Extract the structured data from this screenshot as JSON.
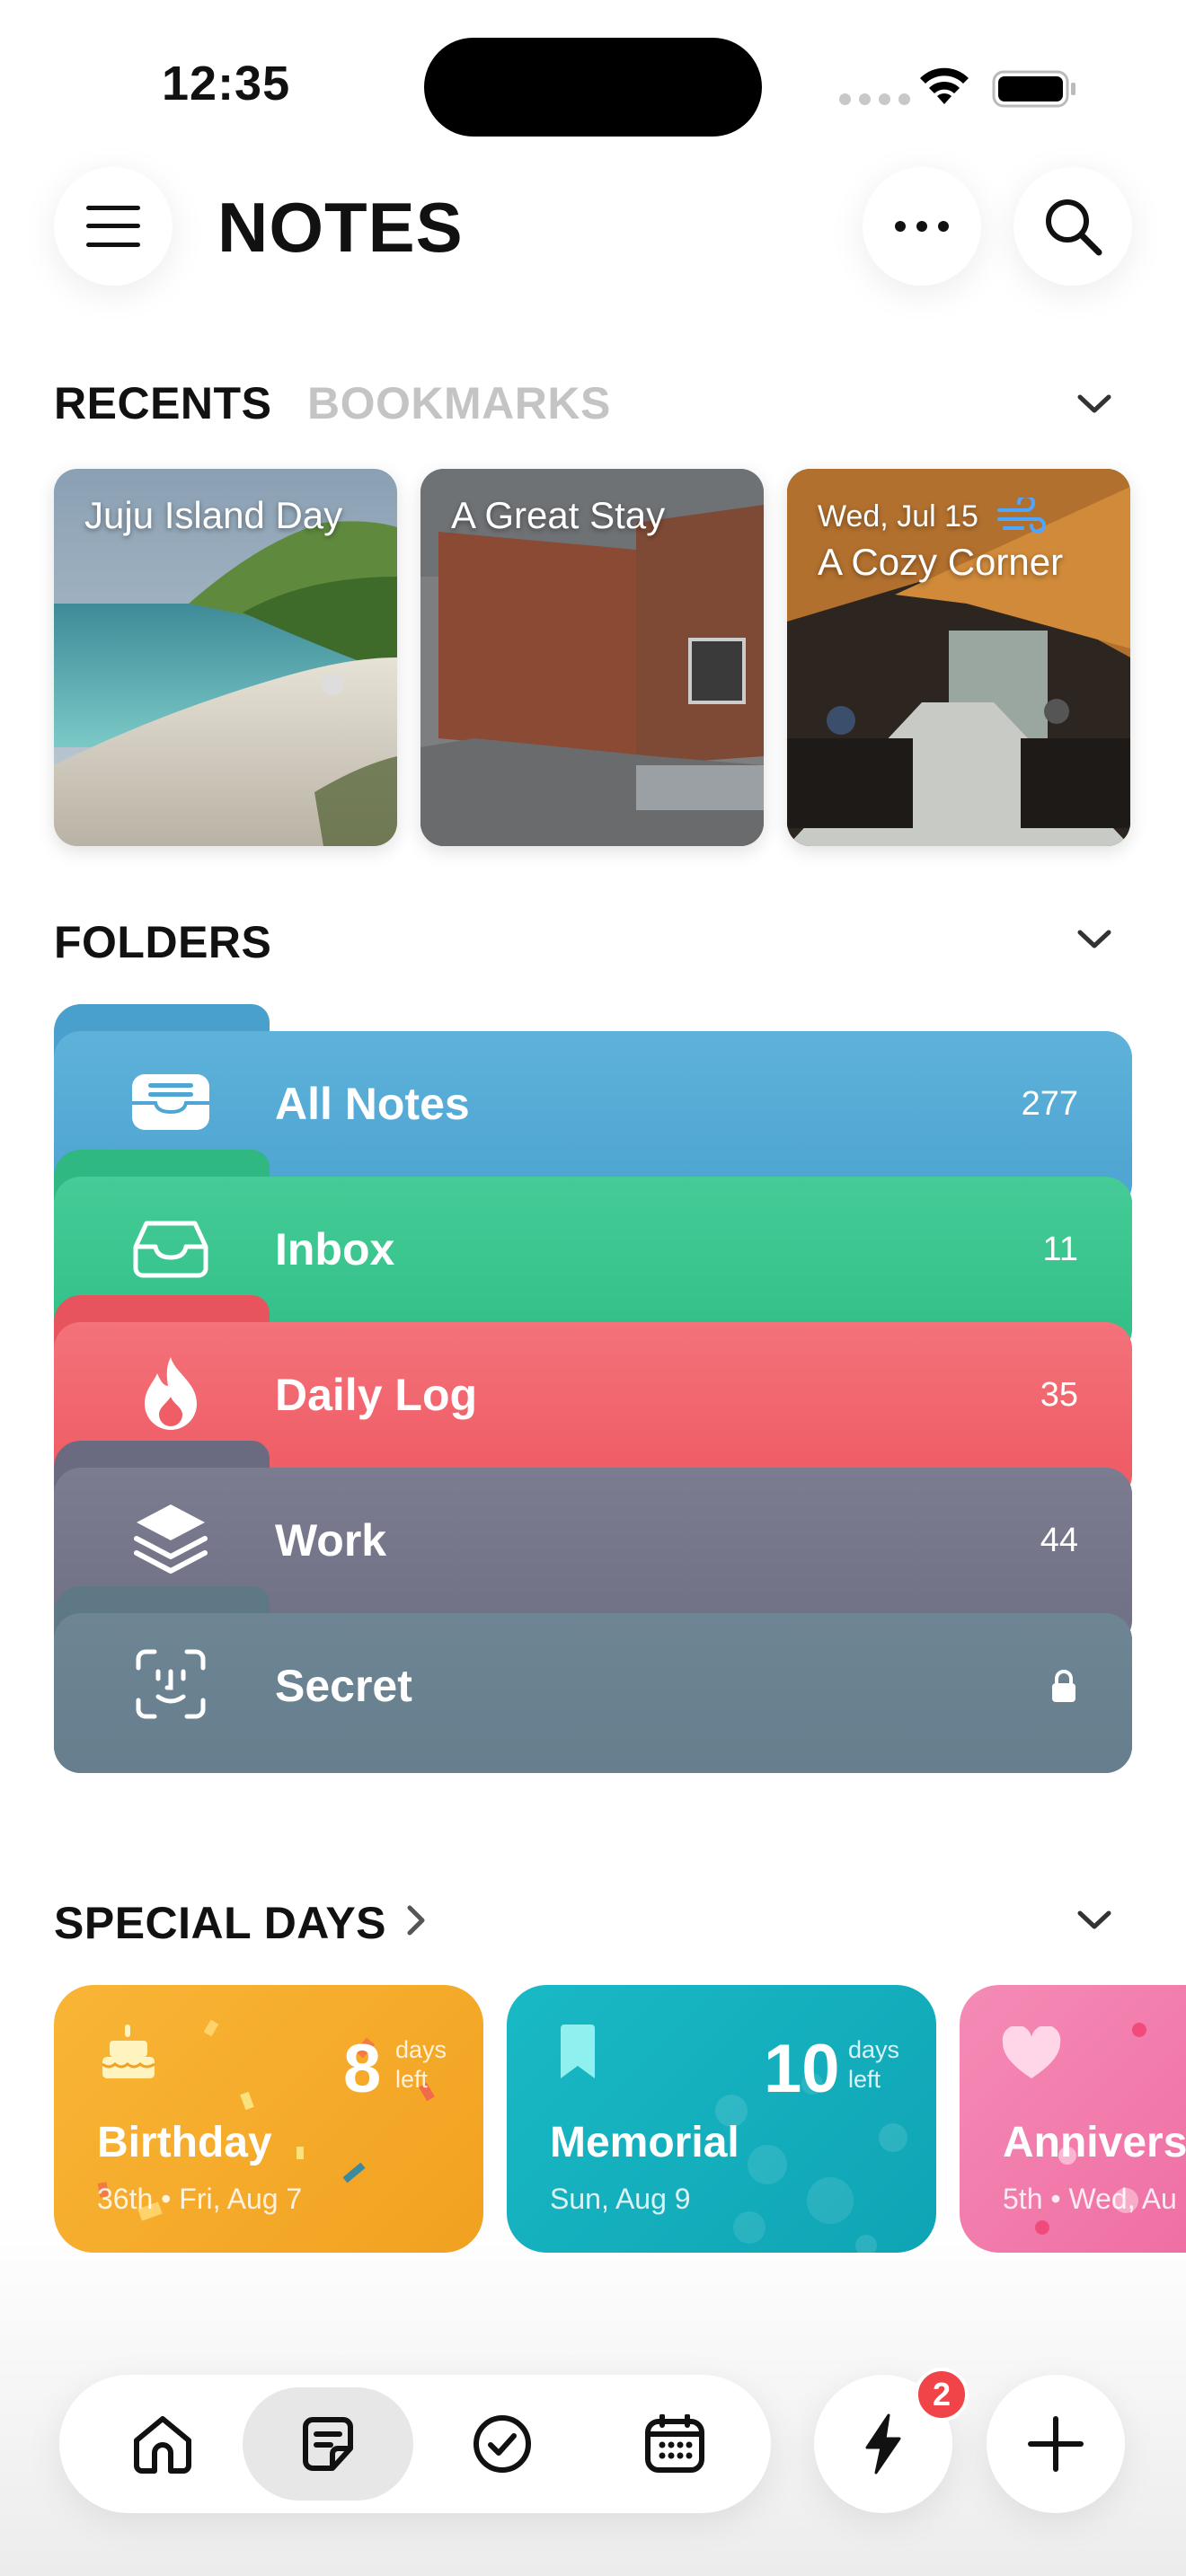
{
  "status": {
    "time": "12:35"
  },
  "header": {
    "title": "NOTES"
  },
  "recents": {
    "tabs": [
      "RECENTS",
      "BOOKMARKS"
    ],
    "cards": [
      {
        "title": "Juju Island Day"
      },
      {
        "title": "A Great Stay"
      },
      {
        "date": "Wed, Jul 15",
        "title": "A Cozy Corner",
        "weather_icon": "wind-icon"
      }
    ]
  },
  "folders": {
    "label": "FOLDERS",
    "items": [
      {
        "name": "All Notes",
        "count": "277",
        "icon": "tray-full-icon",
        "color": "#4fa6d2"
      },
      {
        "name": "Inbox",
        "count": "11",
        "icon": "tray-icon",
        "color": "#34c189"
      },
      {
        "name": "Daily Log",
        "count": "35",
        "icon": "flame-icon",
        "color": "#ef5d66"
      },
      {
        "name": "Work",
        "count": "44",
        "icon": "layers-icon",
        "color": "#727287"
      },
      {
        "name": "Secret",
        "count": "",
        "icon": "face-id-icon",
        "lock_icon": "lock-icon",
        "color": "#667e8d"
      }
    ]
  },
  "special_days": {
    "label": "SPECIAL DAYS",
    "items": [
      {
        "title": "Birthday",
        "sub": "36th • Fri, Aug 7",
        "num": "8",
        "unit1": "days",
        "unit2": "left",
        "icon": "cake-icon",
        "color": "#f6ad2a"
      },
      {
        "title": "Memorial",
        "sub": "Sun, Aug 9",
        "num": "10",
        "unit1": "days",
        "unit2": "left",
        "icon": "bookmark-icon",
        "color": "#14b0bf"
      },
      {
        "title": "Annivers",
        "sub": "5th • Wed, Au",
        "icon": "heart-icon",
        "color": "#f07bab"
      }
    ]
  },
  "tabbar": {
    "tabs": [
      "home-icon",
      "note-icon",
      "check-circle-icon",
      "calendar-icon"
    ],
    "active": "note-icon",
    "quick_badge": "2"
  }
}
